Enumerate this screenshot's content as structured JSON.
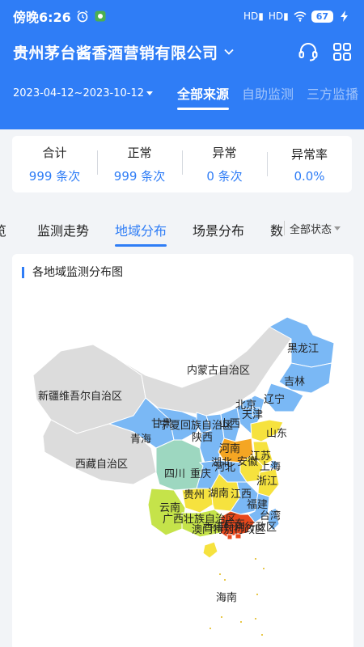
{
  "status_bar": {
    "time": "傍晚6:26",
    "battery": "67"
  },
  "header": {
    "company": "贵州茅台酱香酒营销有限公司",
    "date_range": "2023-04-12~2023-10-12",
    "source_tabs": [
      "全部来源",
      "自助监测",
      "三方监播"
    ]
  },
  "summary": [
    {
      "label": "合计",
      "value": "999 条次"
    },
    {
      "label": "正常",
      "value": "999 条次"
    },
    {
      "label": "异常",
      "value": "0 条次"
    },
    {
      "label": "异常率",
      "value": "0.0%"
    }
  ],
  "tabs": {
    "items": [
      "览",
      "监测走势",
      "地域分布",
      "场景分布",
      "数"
    ],
    "status_filter": "全部状态"
  },
  "map": {
    "title": "各地域监测分布图",
    "colors": {
      "blue": "#7ab8f5",
      "gray": "#dcdcdc",
      "yellow": "#f6e23e",
      "orange": "#f5a623",
      "red": "#e8481c",
      "lime": "#c5e34a",
      "teal": "#9dd7c0",
      "green": "#a3d977"
    },
    "regions": [
      {
        "name": "黑龙江",
        "color": "blue"
      },
      {
        "name": "吉林",
        "color": "blue"
      },
      {
        "name": "辽宁",
        "color": "blue"
      },
      {
        "name": "内蒙古自治区",
        "color": "gray"
      },
      {
        "name": "新疆维吾尔自治区",
        "color": "gray"
      },
      {
        "name": "西藏自治区",
        "color": "gray"
      },
      {
        "name": "青海",
        "color": "blue"
      },
      {
        "name": "甘肃",
        "color": "blue"
      },
      {
        "name": "宁夏回族自治区",
        "color": "blue"
      },
      {
        "name": "山西",
        "color": "blue"
      },
      {
        "name": "北京",
        "color": "blue"
      },
      {
        "name": "天津",
        "color": "blue"
      },
      {
        "name": "河北",
        "color": "blue"
      },
      {
        "name": "山东",
        "color": "yellow"
      },
      {
        "name": "陕西",
        "color": "blue"
      },
      {
        "name": "河南",
        "color": "orange"
      },
      {
        "name": "江苏",
        "color": "yellow"
      },
      {
        "name": "安徽",
        "color": "yellow"
      },
      {
        "name": "上海",
        "color": "blue"
      },
      {
        "name": "四川",
        "color": "teal"
      },
      {
        "name": "重庆",
        "color": "blue"
      },
      {
        "name": "湖北",
        "color": "blue"
      },
      {
        "name": "浙江",
        "color": "yellow"
      },
      {
        "name": "贵州",
        "color": "yellow"
      },
      {
        "name": "湖南",
        "color": "yellow"
      },
      {
        "name": "江西",
        "color": "blue"
      },
      {
        "name": "福建",
        "color": "blue"
      },
      {
        "name": "云南",
        "color": "lime"
      },
      {
        "name": "广西壮族自治区",
        "color": "lime"
      },
      {
        "name": "广东",
        "color": "red"
      },
      {
        "name": "澳门特别行政区",
        "color": "red"
      },
      {
        "name": "香港特别行政区",
        "color": "red"
      },
      {
        "name": "台湾",
        "color": "blue"
      },
      {
        "name": "海南",
        "color": "yellow"
      }
    ],
    "sea_label": "海南"
  }
}
